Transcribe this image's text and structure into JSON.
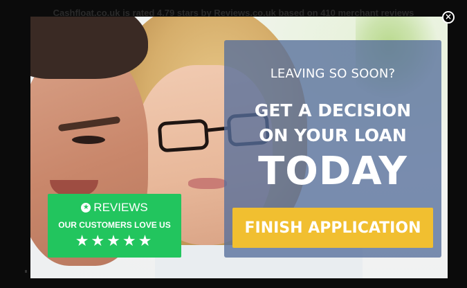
{
  "background_page": {
    "rating_text": "Cashfloat.co.uk is rated 4.79 stars by Reviews.co.uk based on 410 merchant reviews"
  },
  "modal": {
    "eyebrow": "LEAVING SO SOON?",
    "headline_line1": "GET A DECISION",
    "headline_line2": "ON YOUR LOAN",
    "headline_emphasis": "TODAY",
    "cta_label": "FINISH APPLICATION",
    "close_icon": "×",
    "close_icon_name": "close-icon"
  },
  "reviews_badge": {
    "brand": "REVIEWS",
    "brand_icon": "★",
    "brand_icon_name": "star-circle-icon",
    "tagline": "OUR CUSTOMERS LOVE US",
    "stars": "★★★★★",
    "rating_stars": 5
  },
  "colors": {
    "panel_overlay": "#566e9b",
    "cta_button": "#f1bf30",
    "reviews_green": "#22c55e"
  }
}
